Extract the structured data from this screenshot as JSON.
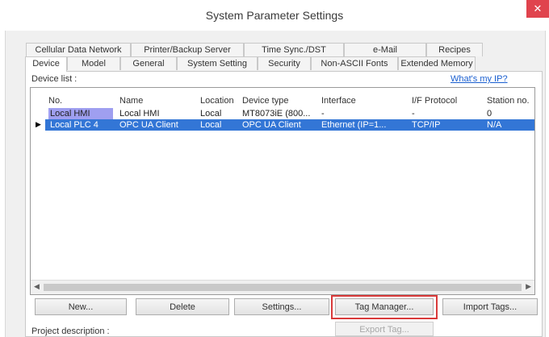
{
  "window": {
    "title": "System Parameter Settings",
    "close_glyph": "✕"
  },
  "tabs_row1": [
    {
      "label": "Cellular Data Network"
    },
    {
      "label": "Printer/Backup Server"
    },
    {
      "label": "Time Sync./DST"
    },
    {
      "label": "e-Mail"
    },
    {
      "label": "Recipes"
    }
  ],
  "tabs_row2": [
    {
      "label": "Device"
    },
    {
      "label": "Model"
    },
    {
      "label": "General"
    },
    {
      "label": "System Setting"
    },
    {
      "label": "Security"
    },
    {
      "label": "Non-ASCII Fonts"
    },
    {
      "label": "Extended Memory"
    }
  ],
  "active_tab": "Device",
  "device_list": {
    "label": "Device list :",
    "help_link": "What's my IP?",
    "columns": [
      "No.",
      "Name",
      "Location",
      "Device type",
      "Interface",
      "I/F Protocol",
      "Station no."
    ],
    "rows": [
      {
        "no": "Local HMI",
        "name": "Local HMI",
        "location": "Local",
        "type": "MT8073iE (800...",
        "interface": "-",
        "protocol": "-",
        "station": "0",
        "selected": false
      },
      {
        "no": "Local PLC 4",
        "name": "OPC UA Client",
        "location": "Local",
        "type": "OPC UA Client",
        "interface": "Ethernet (IP=1...",
        "protocol": "TCP/IP",
        "station": "N/A",
        "selected": true
      }
    ]
  },
  "buttons": {
    "new": "New...",
    "delete": "Delete",
    "settings": "Settings...",
    "tag_manager": "Tag Manager...",
    "import_tags": "Import Tags...",
    "export_tag": "Export Tag..."
  },
  "project_description_label": "Project description :",
  "colors": {
    "selection": "#3376d6",
    "local_hmi_no_bg": "#9f9ff0",
    "highlight": "#d93a3a"
  }
}
